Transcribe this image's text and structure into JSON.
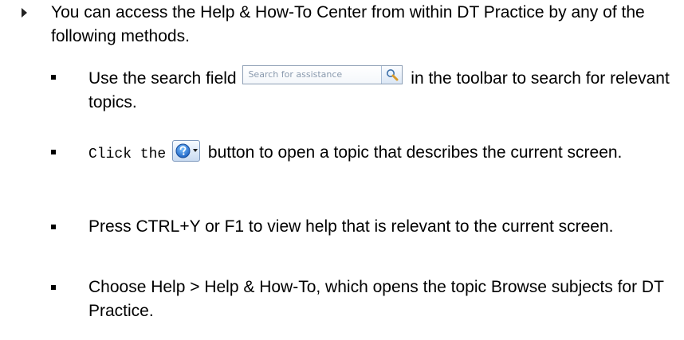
{
  "intro": "You can access the Help & How-To Center from within DT Practice by any of the following methods.",
  "search_field": {
    "placeholder": "Search for assistance",
    "icon": "magnifier-icon"
  },
  "help_button": {
    "icon": "help-question-icon"
  },
  "items": [
    {
      "before": "Use the search field",
      "after": "in the toolbar to search for relevant topics."
    },
    {
      "before": "Click the",
      "after": "button to open a topic that describes the current screen."
    },
    {
      "text": "Press CTRL+Y or F1 to view help that is relevant to the current screen."
    },
    {
      "text": "Choose Help > Help & How-To, which opens the topic Browse subjects for DT Practice."
    }
  ]
}
